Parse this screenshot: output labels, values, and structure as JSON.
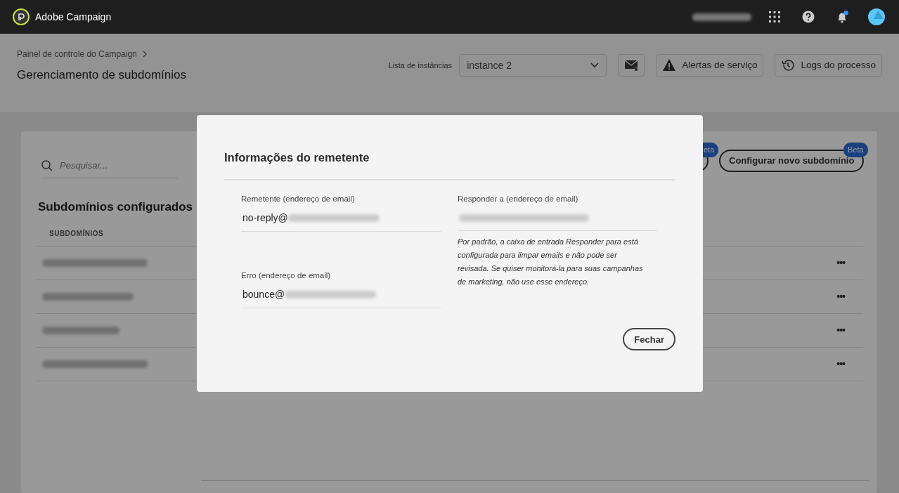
{
  "app": {
    "name": "Adobe Campaign",
    "user_redacted": true,
    "notifications": true
  },
  "header": {
    "breadcrumb": "Painel de controle do Campaign",
    "title": "Gerenciamento de subdomínios",
    "instance_label": "Lista de instâncias",
    "instance_value": "instance 2",
    "buttons": [
      {
        "kind": "mail-alert"
      },
      {
        "kind": "alert",
        "label": "Alertas de serviço"
      },
      {
        "kind": "history",
        "label": "Logs do processo"
      }
    ]
  },
  "panel": {
    "search_placeholder": "Pesquisar...",
    "heading": "Subdomínios configurados",
    "column": "SUBDOMÍNIOS",
    "rows": [
      {
        "kind": "redacted",
        "menu": "•••"
      },
      {
        "kind": "redacted",
        "menu": "•••"
      },
      {
        "kind": "redacted",
        "menu": "•••"
      },
      {
        "kind": "redacted",
        "menu": "•••"
      }
    ],
    "actions": [
      {
        "kind": "partial",
        "badge": "eta"
      },
      {
        "kind": "full",
        "label": "Configurar novo subdomínio",
        "badge": "Beta"
      }
    ]
  },
  "modal": {
    "title": "Informações do remetente",
    "fields": [
      {
        "label": "Remetente (endereço de email)",
        "value": "no-reply@",
        "domain_redacted": true
      },
      {
        "label": "Erro (endereço de email)",
        "value": "bounce@",
        "domain_redacted": true
      }
    ],
    "reply_to": {
      "label": "Responder a (endereço de email)",
      "value_redacted": true,
      "note": "Por padrão, a caixa de entrada Responder para está configurada para limpar emails e não pode ser revisada. Se quiser monitorá-la para suas campanhas de marketing, não use esse endereço."
    },
    "close": "Fechar"
  }
}
